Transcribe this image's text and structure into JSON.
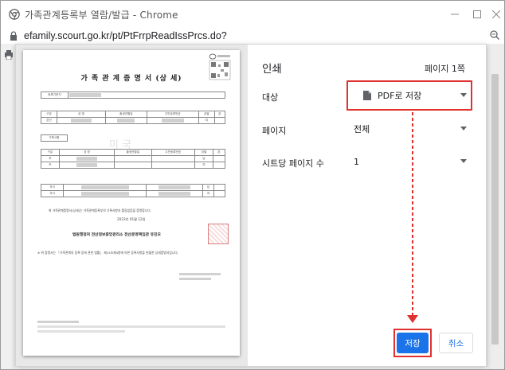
{
  "window": {
    "title": "가족관계등록부 열람/발급 - Chrome",
    "url": "efamily.scourt.go.kr/pt/PtFrrpReadIssPrcs.do?"
  },
  "preview": {
    "doc_title": "가 족 관 계 증 명 서 (상 세)",
    "reg_label": "등록기준지",
    "columns": [
      "구분",
      "성 명",
      "출생연월일",
      "주민등록번호",
      "성별",
      "본"
    ],
    "row_self": "본인",
    "family_label": "가족사항",
    "family_rows": [
      "부",
      "모",
      "자녀",
      "자녀"
    ],
    "genders": [
      "여",
      "남",
      "여",
      "남",
      "여"
    ],
    "statement": "위 가족관계증명서(상세)는 가족관계등록부의 기록사항과 틀림없음을 증명합니다.",
    "date": "2023년 01월 12일",
    "issuer": "법원행정처 전산정보중앙관리소 전산운영책임관 유진오",
    "notice": "※ 위 증명서는 「가족관계의 등록 등에 관한 법률」 제15조제4항에 따른 등록사항을 현출한 상세증명서입니다.",
    "watermark": "미 국"
  },
  "settings": {
    "title": "인쇄",
    "page_count": "페이지 1쪽",
    "destination_label": "대상",
    "destination_value": "PDF로 저장",
    "pages_label": "페이지",
    "pages_value": "전체",
    "sheets_label": "시트당 페이지 수",
    "sheets_value": "1",
    "save_label": "저장",
    "cancel_label": "취소"
  },
  "colors": {
    "highlight": "#e0312f",
    "primary": "#1a73e8"
  }
}
